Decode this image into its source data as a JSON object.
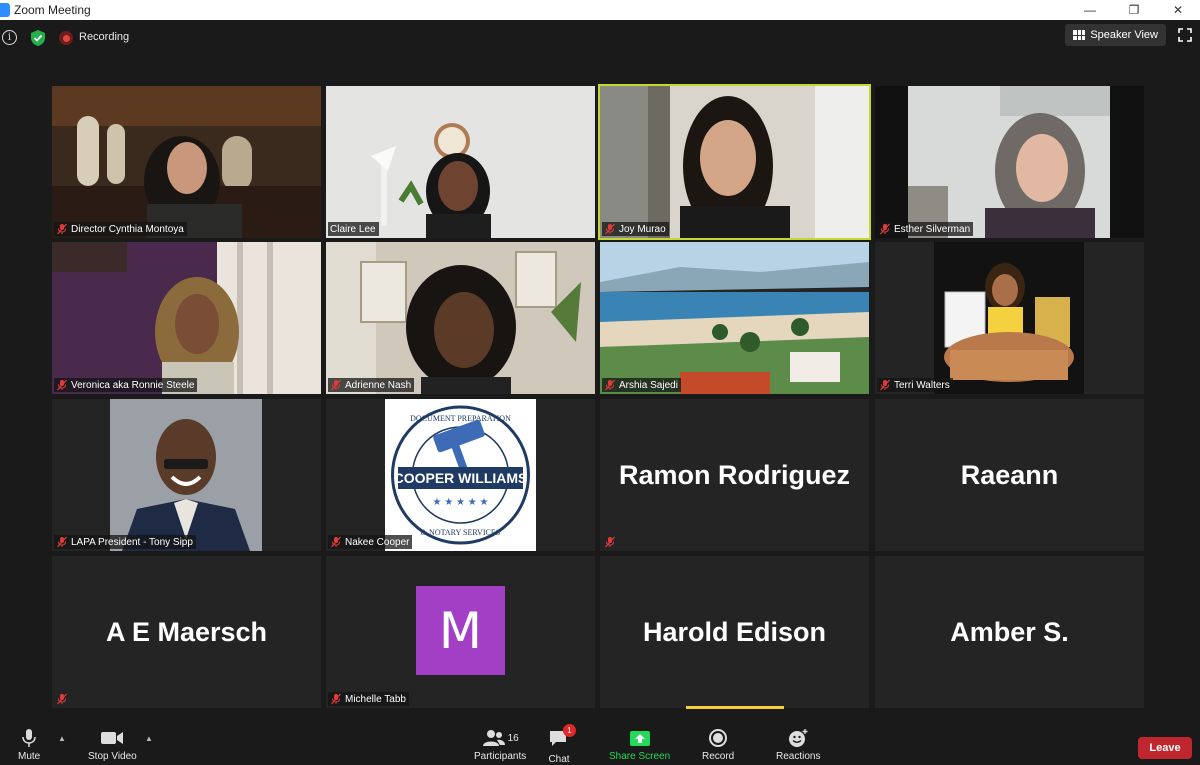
{
  "window": {
    "title": "Zoom Meeting",
    "controls": [
      "—",
      "❐",
      "✕"
    ]
  },
  "topbar": {
    "recording_label": "Recording",
    "speaker_view_label": "Speaker View"
  },
  "tiles": [
    {
      "name": "Director Cynthia Montoya",
      "muted": true
    },
    {
      "name": "Claire Lee",
      "muted": false
    },
    {
      "name": "Joy Murao",
      "muted": true,
      "active": true
    },
    {
      "name": "Esther Silverman",
      "muted": true
    },
    {
      "name": "Veronica aka Ronnie Steele",
      "muted": true
    },
    {
      "name": "Adrienne Nash",
      "muted": true
    },
    {
      "name": "Arshia Sajedi",
      "muted": true
    },
    {
      "name": "Terri Walters",
      "muted": true
    },
    {
      "name": "LAPA President - Tony Sipp",
      "muted": true
    },
    {
      "name": "Nakee Cooper",
      "muted": true
    },
    {
      "name": "Ramon Rodriguez",
      "muted": true,
      "display_name": "Ramon Rodriguez"
    },
    {
      "name": "Raeann",
      "muted": false,
      "display_name": "Raeann"
    },
    {
      "name": "A E Maersch",
      "muted": true,
      "display_name": "A E Maersch"
    },
    {
      "name": "Michelle Tabb",
      "muted": true,
      "avatar_letter": "M"
    },
    {
      "name": "Harold Edison",
      "muted": false,
      "display_name": "Harold Edison"
    },
    {
      "name": "Amber S.",
      "muted": false,
      "display_name": "Amber S."
    }
  ],
  "logo": {
    "text_top": "DOCUMENT PREPARATION",
    "text_main": "COOPER WILLIAMS",
    "text_bottom": "& NOTARY SERVICES"
  },
  "toolbar": {
    "mute_label": "Mute",
    "video_label": "Stop Video",
    "participants_label": "Participants",
    "participants_count": "16",
    "chat_label": "Chat",
    "chat_badge": "1",
    "share_label": "Share Screen",
    "record_label": "Record",
    "reactions_label": "Reactions",
    "leave_label": "Leave"
  },
  "colors": {
    "active_speaker": "#c4d82f",
    "leave": "#c0262d",
    "share": "#23d959",
    "avatar_m": "#a33fc4"
  }
}
